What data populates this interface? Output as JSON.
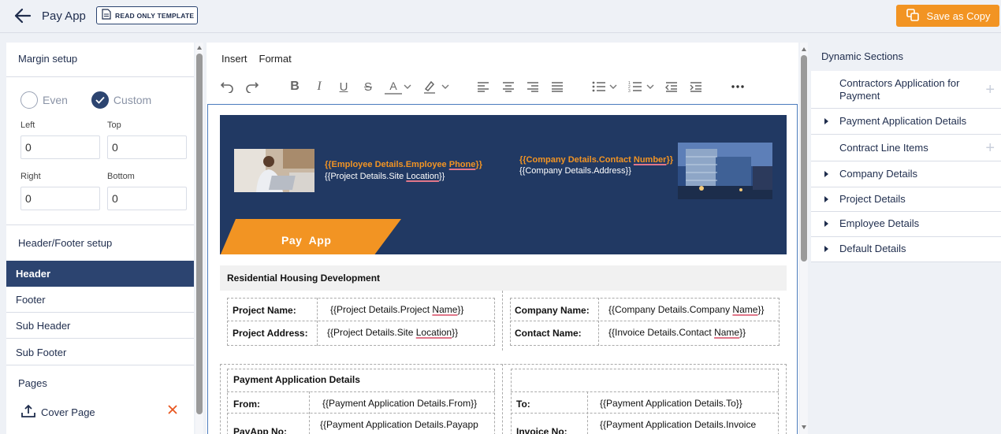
{
  "header": {
    "title": "Pay App",
    "badge": "READ ONLY TEMPLATE",
    "save_label": "Save as Copy"
  },
  "left": {
    "margin_title": "Margin setup",
    "even_label": "Even",
    "custom_label": "Custom",
    "left_label": "Left",
    "top_label": "Top",
    "right_label": "Right",
    "bottom_label": "Bottom",
    "left_value": "0",
    "top_value": "0",
    "right_value": "0",
    "bottom_value": "0",
    "hf_title": "Header/Footer setup",
    "hf_items": [
      "Header",
      "Footer",
      "Sub Header",
      "Sub Footer"
    ],
    "pages_title": "Pages",
    "cover_label": "Cover Page"
  },
  "editor": {
    "menu": [
      "Insert",
      "Format"
    ],
    "banner": {
      "emp_line1_a": "{{Employee Details.Employee ",
      "emp_line1_b": "Phone",
      "emp_line1_c": "}}",
      "emp_line2_a": "{{Project Details.Site ",
      "emp_line2_b": "Location",
      "emp_line2_c": "}}",
      "co_line1_a": "{{Company Details.Contact ",
      "co_line1_b": "Number",
      "co_line1_c": "}}",
      "co_line2": "{{Company Details.Address}}",
      "tab_label": "Pay  App"
    },
    "section_title": "Residential Housing Development",
    "project_name_label": "Project Name:",
    "project_name_value_a": "{{Project Details.Project ",
    "project_name_value_b": "Name",
    "project_name_value_c": "}}",
    "project_address_label": "Project Address:",
    "project_address_value_a": "{{Project Details.Site ",
    "project_address_value_b": "Location",
    "project_address_value_c": "}}",
    "company_name_label": "Company Name:",
    "company_name_value_a": "{{Company Details.Company ",
    "company_name_value_b": "Name",
    "company_name_value_c": "}}",
    "contact_name_label": "Contact Name:",
    "contact_name_value_a": "{{Invoice Details.Contact ",
    "contact_name_value_b": "Name",
    "contact_name_value_c": "}}",
    "pa_title": "Payment Application Details",
    "from_label": "From:",
    "from_value": "{{Payment Application Details.From}}",
    "to_label": "To:",
    "to_value": "{{Payment Application Details.To}}",
    "payapp_no_label": "PayApp No:",
    "payapp_no_value": "{{Payment Application Details.Payapp",
    "invoice_no_label": "Invoice No:",
    "invoice_no_value": "{{Payment Application Details.Invoice"
  },
  "right": {
    "title": "Dynamic Sections",
    "items": [
      "Contractors Application for Payment",
      "Payment Application Details",
      "Contract Line Items",
      "Company Details",
      "Project Details",
      "Employee Details",
      "Default Details"
    ]
  },
  "colors": {
    "accent": "#f29423",
    "navy": "#2c4470",
    "banner": "#213963"
  }
}
